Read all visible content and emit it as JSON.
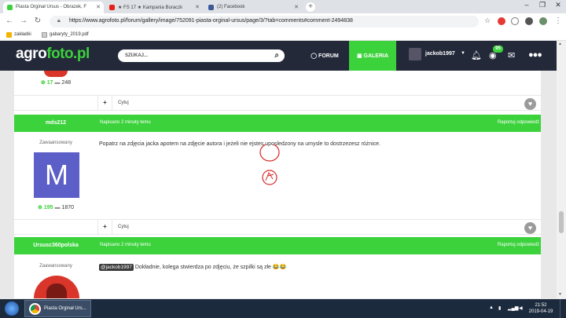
{
  "browser": {
    "tabs": [
      {
        "title": "Piasta Orginał Ursus - Obrazek, F",
        "active": true
      },
      {
        "title": "★ FS 17 ★ Kampania Buraczk",
        "active": false
      },
      {
        "title": "(2) Facebook",
        "active": false
      }
    ],
    "url": "https://www.agrofoto.pl/forum/gallery/image/752091-piasta-orginal-ursus/page/3/?tab=comments#comment-2494838",
    "bookmarks": [
      "zakładki",
      "gabaryty_2019.pdf"
    ]
  },
  "site": {
    "logo_part1": "agro",
    "logo_part2": "foto.pl",
    "search_placeholder": "SZUKAJ...",
    "nav": [
      {
        "label": "FORUM",
        "active": false
      },
      {
        "label": "GALERIA",
        "active": true
      }
    ],
    "username": "jackob1997",
    "notifications_badge": "95"
  },
  "posts": [
    {
      "reputation": "17",
      "posts": "248",
      "quote_label": "Cytuj"
    },
    {
      "author": "mds212",
      "rank": "Zawaansowany",
      "posted": "Napisano 2 minuty temu",
      "report": "Raportuj odpowiedź",
      "avatar_letter": "M",
      "reputation": "195",
      "posts": "1870",
      "text": "Popatrz na zdjęcia jacka apotem na zdjęcie autora i jeżeli nie ejstes uposledzony na umysle to dostrzezesz różnice.",
      "quote_label": "Cytuj"
    },
    {
      "author": "Ursusc360polska",
      "rank": "Zaawansowany",
      "posted": "Napisano 2 minuty temu",
      "report": "Raportuj odpowiedź",
      "mention": "@jackob1997",
      "text": "Dokładnie, kolega stwierdza po zdjęciu, że szpilki są złe 😂😂"
    }
  ],
  "taskbar": {
    "app_label": "Piasta Orginał Urs...",
    "time": "21:52",
    "date": "2019-04-19"
  },
  "colors": {
    "brand_green": "#3cd23c",
    "header_dark": "#24293a",
    "avatar_purple": "#5b5fc7"
  }
}
